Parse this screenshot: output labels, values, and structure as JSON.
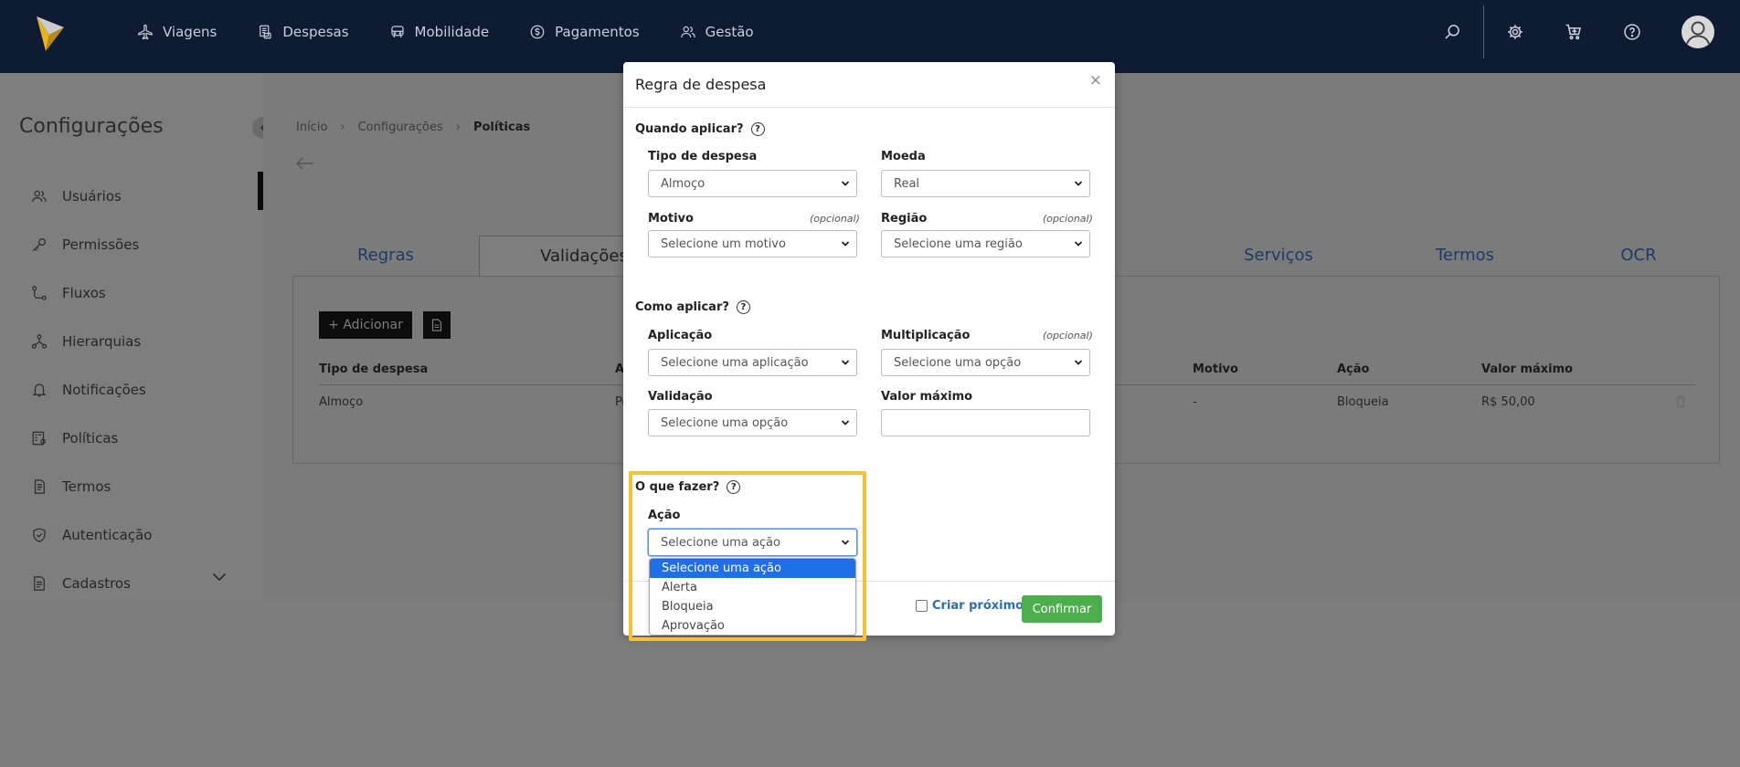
{
  "nav": {
    "items": [
      {
        "label": "Viagens",
        "icon": "plane-icon"
      },
      {
        "label": "Despesas",
        "icon": "receipt-icon"
      },
      {
        "label": "Mobilidade",
        "icon": "car-icon"
      },
      {
        "label": "Pagamentos",
        "icon": "dollar-icon"
      },
      {
        "label": "Gestão",
        "icon": "users-icon"
      }
    ],
    "right_icons": [
      "search-icon",
      "gear-icon",
      "cart-icon",
      "help-icon",
      "avatar-icon"
    ]
  },
  "sidebar": {
    "title": "Configurações",
    "items": [
      {
        "label": "Usuários",
        "icon": "users-icon"
      },
      {
        "label": "Permissões",
        "icon": "key-icon"
      },
      {
        "label": "Fluxos",
        "icon": "flow-icon"
      },
      {
        "label": "Hierarquias",
        "icon": "hierarchy-icon"
      },
      {
        "label": "Notificações",
        "icon": "bell-icon"
      },
      {
        "label": "Políticas",
        "icon": "policy-icon"
      },
      {
        "label": "Termos",
        "icon": "document-icon"
      },
      {
        "label": "Autenticação",
        "icon": "shield-icon"
      },
      {
        "label": "Cadastros",
        "icon": "register-icon"
      }
    ]
  },
  "breadcrumb": {
    "items": [
      "Início",
      "Configurações",
      "Políticas"
    ]
  },
  "tabs": [
    "Regras",
    "Validações",
    "Serviços",
    "Termos",
    "OCR"
  ],
  "panel": {
    "add_label": "+ Adicionar",
    "columns": [
      "Tipo de despesa",
      "A",
      "Motivo",
      "Ação",
      "Valor máximo"
    ],
    "row": {
      "tipo": "Almoço",
      "partial": "Po",
      "motivo": "-",
      "acao": "Bloqueia",
      "valor": "R$ 50,00"
    }
  },
  "modal": {
    "title": "Regra de despesa",
    "close": "×",
    "when_title": "Quando aplicar?",
    "how_title": "Como aplicar?",
    "what_title": "O que fazer?",
    "help_glyph": "?",
    "optional": "(opcional)",
    "fields": {
      "tipo": {
        "label": "Tipo de despesa",
        "value": "Almoço"
      },
      "moeda": {
        "label": "Moeda",
        "value": "Real"
      },
      "motivo": {
        "label": "Motivo",
        "value": "Selecione um motivo"
      },
      "regiao": {
        "label": "Região",
        "value": "Selecione uma região"
      },
      "aplicacao": {
        "label": "Aplicação",
        "value": "Selecione uma aplicação"
      },
      "multiplicacao": {
        "label": "Multiplicação",
        "value": "Selecione uma opção"
      },
      "validacao": {
        "label": "Validação",
        "value": "Selecione uma opção"
      },
      "valor_maximo": {
        "label": "Valor máximo",
        "value": ""
      },
      "acao": {
        "label": "Ação",
        "value": "Selecione uma ação"
      }
    },
    "acao_options": [
      "Selecione uma ação",
      "Alerta",
      "Bloqueia",
      "Aprovação"
    ],
    "criar_proximo": "Criar próximo",
    "confirm": "Confirmar"
  },
  "colors": {
    "topbar": "#0f1a33",
    "confirm": "#4cae4c",
    "highlight": "#f5c040",
    "selected_option": "#1f6fe6",
    "link": "#2f6fad"
  }
}
